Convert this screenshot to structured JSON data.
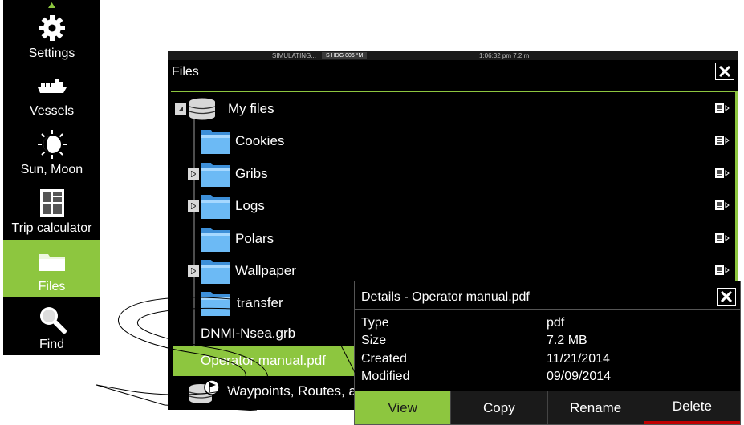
{
  "sidebar": {
    "items": [
      {
        "label": "Settings",
        "icon": "gear-icon"
      },
      {
        "label": "Vessels",
        "icon": "vessels-icon"
      },
      {
        "label": "Sun, Moon",
        "icon": "sun-moon-icon"
      },
      {
        "label": "Trip calculator",
        "icon": "calculator-icon"
      },
      {
        "label": "Files",
        "icon": "folder-icon",
        "active": true
      },
      {
        "label": "Find",
        "icon": "magnifier-icon"
      }
    ]
  },
  "status": {
    "simulating": "SIMULATING...",
    "heading": "S HDG 006 °M",
    "time": "1:06:32 pm  7.2 m"
  },
  "files_window": {
    "title": "Files",
    "tree": [
      {
        "label": "My files",
        "icon": "database-icon",
        "expander": "collapse"
      },
      {
        "label": "Cookies",
        "icon": "folder-icon"
      },
      {
        "label": "Gribs",
        "icon": "folder-icon",
        "expander": "expand"
      },
      {
        "label": "Logs",
        "icon": "folder-icon",
        "expander": "expand"
      },
      {
        "label": "Polars",
        "icon": "folder-icon"
      },
      {
        "label": "Wallpaper",
        "icon": "folder-icon",
        "expander": "expand"
      },
      {
        "label": "transfer",
        "icon": "folder-icon"
      },
      {
        "label": "DNMI-Nsea.grb",
        "icon": "file"
      },
      {
        "label": "Operator manual.pdf",
        "icon": "file",
        "selected": true
      },
      {
        "label": "Waypoints, Routes, and T",
        "icon": "waypoint-database-icon"
      }
    ]
  },
  "details": {
    "title": "Details - Operator manual.pdf",
    "rows": [
      {
        "key": "Type",
        "value": "pdf"
      },
      {
        "key": "Size",
        "value": "7.2 MB"
      },
      {
        "key": "Created",
        "value": "11/21/2014"
      },
      {
        "key": "Modified",
        "value": "09/09/2014"
      }
    ],
    "buttons": {
      "view": "View",
      "copy": "Copy",
      "rename": "Rename",
      "delete": "Delete"
    }
  },
  "colors": {
    "accent": "#8dc63f",
    "delete_bar": "#c00000",
    "folder": "#5aaef0"
  }
}
